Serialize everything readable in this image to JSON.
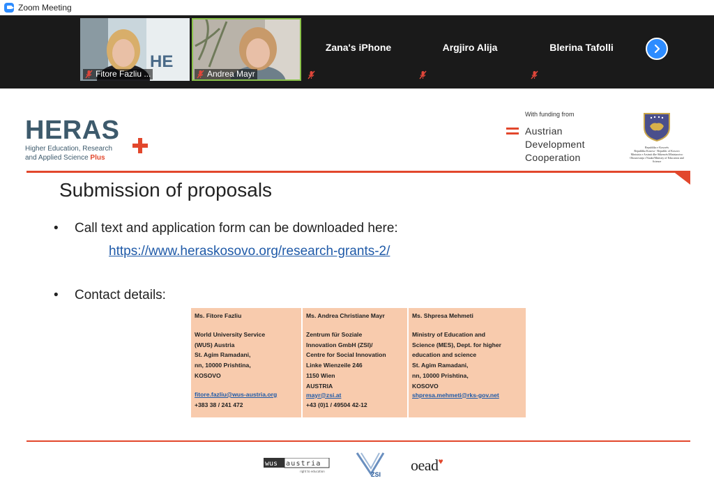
{
  "window": {
    "title": "Zoom Meeting",
    "icon": "zoom-camera-icon"
  },
  "participants": [
    {
      "name": "Fitore Fazliu ...",
      "type": "video",
      "muted": true
    },
    {
      "name": "Andrea Mayr",
      "type": "video",
      "muted": true,
      "speaking": true
    },
    {
      "name": "Zana's iPhone",
      "type": "name",
      "muted": true
    },
    {
      "name": "Argjiro Alija",
      "type": "name",
      "muted": true
    },
    {
      "name": "Blerina Tafolli",
      "type": "name",
      "muted": true
    }
  ],
  "strip": {
    "next_icon": "chevron-right-icon"
  },
  "slide": {
    "logo_word": "HERAS",
    "logo_sub_line1": "Higher Education, Research",
    "logo_sub_line2": "and  Applied  Science",
    "logo_sub_plus": "Plus",
    "funding_label": "With funding from",
    "ada_line1": "Austrian",
    "ada_line2": "Development",
    "ada_line3": "Cooperation",
    "rks_line1": "Republika e Kosovës",
    "rks_line2": "Republika Kosova - Republic of Kosovo",
    "rks_line3": "Ministria e Arsimit dhe Shkencës/Ministarstvo",
    "rks_line4": "Obrazovanja i Nauke/Ministry of Education and",
    "rks_line5": "Science",
    "title": "Submission of proposals",
    "bullet1": "Call text and application form can be downloaded here:",
    "link": "https://www.heraskosovo.org/research-grants-2/",
    "bullet2": "Contact details:",
    "bullet_glyph": "•",
    "contacts": [
      {
        "name": "Ms. Fitore Fazliu",
        "lines": [
          "World University Service",
          "(WUS) Austria",
          "St. Agim Ramadani,",
          "nn, 10000 Prishtina,",
          "KOSOVO"
        ],
        "email": "fitore.fazliu@wus-austria.org",
        "phone": "+383 38 / 241 472"
      },
      {
        "name": "Ms. Andrea Christiane Mayr",
        "lines": [
          "Zentrum für Soziale",
          "Innovation GmbH (ZSI)/",
          "Centre for Social Innovation",
          "Linke Wienzeile 246",
          "1150 Wien",
          "AUSTRIA"
        ],
        "email": "mayr@zsi.at",
        "phone": "+43 (0)1 / 49504 42-12"
      },
      {
        "name": "Ms. Shpresa Mehmeti",
        "lines": [
          "Ministry of Education and",
          "Science (MES), Dept. for higher",
          "education and science",
          "St. Agim Ramadani,",
          "nn, 10000 Prishtina,",
          "KOSOVO"
        ],
        "email": "shpresa.mehmeti@rks-gov.net",
        "phone": ""
      }
    ],
    "footer_logos": {
      "wus": "wus austria",
      "wus_tagline": "right to education",
      "zsi": "ZSI",
      "oead": "oead"
    }
  },
  "colors": {
    "accent_red": "#e2472c",
    "heras_blue": "#3d5a6c",
    "zoom_blue": "#2d8cff",
    "table_bg": "#f8cbad",
    "link_blue": "#1f5aa8"
  }
}
